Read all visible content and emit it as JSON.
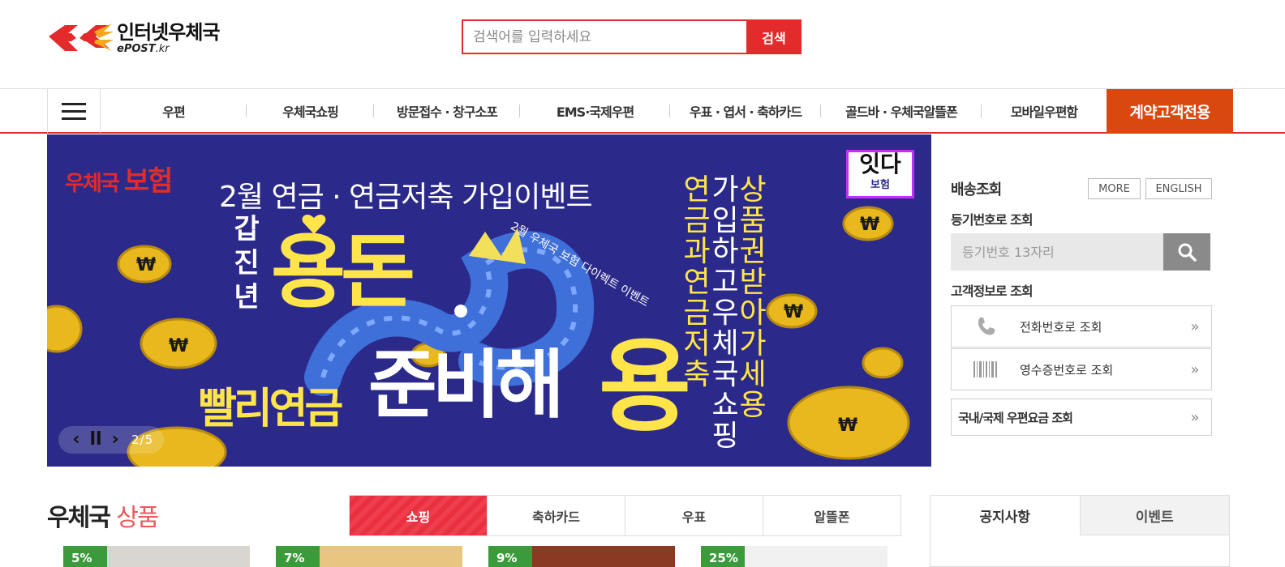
{
  "header": {
    "logo_title": "인터넷우체국",
    "logo_sub": "ePOST",
    "logo_sub_kr": ".kr",
    "search_placeholder": "검색어를 입력하세요",
    "search_button": "검색"
  },
  "nav": {
    "items": [
      "우편",
      "우체국쇼핑",
      "방문접수 · 창구소포",
      "EMS·국제우편",
      "우표 · 엽서 · 축하카드",
      "골드바 · 우체국알뜰폰",
      "모바일우편함"
    ],
    "contract": "계약고객전용"
  },
  "banner": {
    "brand_small": "우체국",
    "brand_big": "보험",
    "event_text": "2월 연금 · 연금저축 가입이벤트",
    "gap_text": "갑진년",
    "headline1": "용돈",
    "headline2_left": "빨리연금",
    "headline2_mid": "준비해",
    "headline2_right": "용",
    "dragon_text": "2월 우체국 보험 다이렉트 이벤트",
    "side_col1": "연금과연금저축",
    "side_col2": "가입하고우체국쇼핑",
    "side_col3": "상품권받아가세용",
    "idda_main": "잇다",
    "idda_sub": "보험",
    "slide_counter": "2/5"
  },
  "panel": {
    "title": "배송조회",
    "more": "MORE",
    "english": "ENGLISH",
    "reg_title": "등기번호로 조회",
    "reg_placeholder": "등기번호 13자리",
    "cust_title": "고객정보로 조회",
    "phone_label": "전화번호로 조회",
    "receipt_label": "영수증번호로 조회",
    "fee_label": "국내/국제 우편요금 조회"
  },
  "products": {
    "title_black": "우체국",
    "title_red": "상품",
    "tabs": [
      "쇼핑",
      "축하카드",
      "우표",
      "알뜰폰"
    ],
    "badges": [
      "5%",
      "7%",
      "9%",
      "25%"
    ]
  },
  "notice": {
    "tabs": [
      "공지사항",
      "이벤트"
    ]
  },
  "colors": {
    "brand_red": "#e32b2b",
    "contract_orange": "#d9480f",
    "banner_navy": "#2b2a8a",
    "banner_yellow": "#ffe54a"
  }
}
